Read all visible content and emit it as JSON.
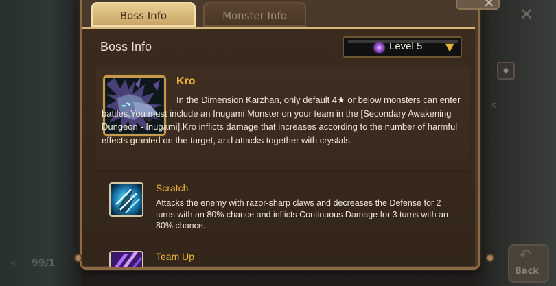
{
  "background": {
    "energy_text": "99/1",
    "back_label": "Back",
    "close_glyph": "✕",
    "diamond_glyph": "◆",
    "side_letter": "s"
  },
  "tabs": [
    {
      "label": "Boss Info",
      "active": true
    },
    {
      "label": "Monster Info",
      "active": false
    }
  ],
  "section_title": "Boss Info",
  "level_select": {
    "label": "Level 5",
    "icon": "dimension-orb-icon",
    "arrow": "▼"
  },
  "boss": {
    "name": "Kro",
    "description": "In the Dimension Karzhan, only default 4★ or below monsters can enter battles.You must include an Inugami Monster on your team in the [Secondary Awakening Dungeon - Inugami].Kro inflicts damage that increases according to the number of harmful effects granted on the target, and attacks together with crystals.",
    "portrait_icon": "wolf-beast-portrait"
  },
  "skills": [
    {
      "name": "Scratch",
      "description": "Attacks the enemy with razor-sharp claws and decreases the Defense for 2 turns with an 80% chance and inflicts Continuous Damage for 3 turns with an 80% chance.",
      "icon": "claw-slash-icon"
    },
    {
      "name": "Team Up",
      "icon": "team-up-icon"
    }
  ],
  "colors": {
    "accent_gold": "#f2b53a",
    "tab_active": "#e9cf94",
    "panel_border": "#8c6a43",
    "text_light": "#efe7d9"
  }
}
